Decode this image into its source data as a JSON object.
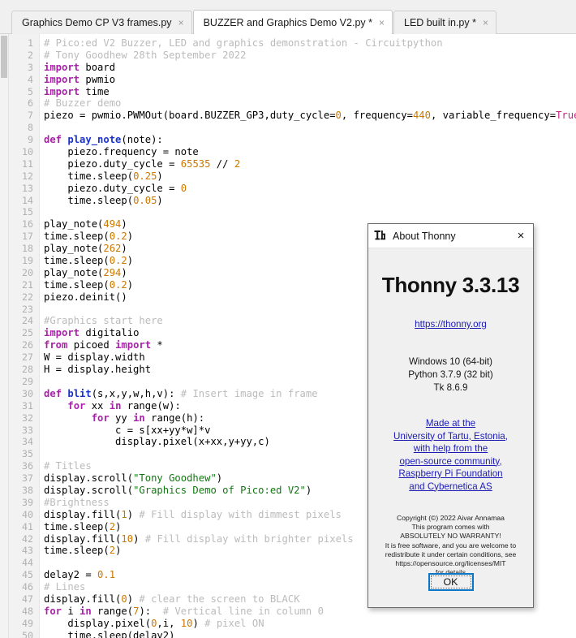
{
  "tabs": [
    {
      "label": "Graphics Demo CP V3 frames.py",
      "close_icon": "×",
      "active": false
    },
    {
      "label": "BUZZER and Graphics Demo V2.py *",
      "close_icon": "×",
      "active": true
    },
    {
      "label": "LED built in.py *",
      "close_icon": "×",
      "active": false
    }
  ],
  "editor": {
    "first_line": 1,
    "lines": [
      {
        "n": "1",
        "tokens": [
          {
            "t": "# Pico:ed V2 Buzzer, LED and graphics demonstration - Circuitpython",
            "c": "c-com"
          }
        ]
      },
      {
        "n": "2",
        "tokens": [
          {
            "t": "# Tony Goodhew 28th September 2022",
            "c": "c-com"
          }
        ]
      },
      {
        "n": "3",
        "tokens": [
          {
            "t": "import",
            "c": "c-kw"
          },
          {
            "t": " board",
            "c": "src"
          }
        ]
      },
      {
        "n": "4",
        "tokens": [
          {
            "t": "import",
            "c": "c-kw"
          },
          {
            "t": " pwmio",
            "c": "src"
          }
        ]
      },
      {
        "n": "5",
        "tokens": [
          {
            "t": "import",
            "c": "c-kw"
          },
          {
            "t": " time",
            "c": "src"
          }
        ]
      },
      {
        "n": "6",
        "tokens": [
          {
            "t": "# Buzzer demo",
            "c": "c-com"
          }
        ]
      },
      {
        "n": "7",
        "tokens": [
          {
            "t": "piezo = pwmio.PWMOut(board.BUZZER_GP3,duty_cycle=",
            "c": "src"
          },
          {
            "t": "0",
            "c": "c-num"
          },
          {
            "t": ", frequency=",
            "c": "src"
          },
          {
            "t": "440",
            "c": "c-num"
          },
          {
            "t": ", variable_frequency=",
            "c": "src"
          },
          {
            "t": "True",
            "c": "c-bool"
          },
          {
            "t": ")",
            "c": "src"
          }
        ]
      },
      {
        "n": "8",
        "tokens": []
      },
      {
        "n": "9",
        "tokens": [
          {
            "t": "def ",
            "c": "c-kw"
          },
          {
            "t": "play_note",
            "c": "c-fn"
          },
          {
            "t": "(note):",
            "c": "src"
          }
        ]
      },
      {
        "n": "10",
        "tokens": [
          {
            "t": "    piezo.frequency = note",
            "c": "src"
          }
        ]
      },
      {
        "n": "11",
        "tokens": [
          {
            "t": "    piezo.duty_cycle = ",
            "c": "src"
          },
          {
            "t": "65535",
            "c": "c-num"
          },
          {
            "t": " // ",
            "c": "src"
          },
          {
            "t": "2",
            "c": "c-num"
          }
        ]
      },
      {
        "n": "12",
        "tokens": [
          {
            "t": "    time.sleep(",
            "c": "src"
          },
          {
            "t": "0.25",
            "c": "c-num"
          },
          {
            "t": ")",
            "c": "src"
          }
        ]
      },
      {
        "n": "13",
        "tokens": [
          {
            "t": "    piezo.duty_cycle = ",
            "c": "src"
          },
          {
            "t": "0",
            "c": "c-num"
          }
        ]
      },
      {
        "n": "14",
        "tokens": [
          {
            "t": "    time.sleep(",
            "c": "src"
          },
          {
            "t": "0.05",
            "c": "c-num"
          },
          {
            "t": ")",
            "c": "src"
          }
        ]
      },
      {
        "n": "15",
        "tokens": []
      },
      {
        "n": "16",
        "tokens": [
          {
            "t": "play_note(",
            "c": "src"
          },
          {
            "t": "494",
            "c": "c-num"
          },
          {
            "t": ")",
            "c": "src"
          }
        ]
      },
      {
        "n": "17",
        "tokens": [
          {
            "t": "time.sleep(",
            "c": "src"
          },
          {
            "t": "0.2",
            "c": "c-num"
          },
          {
            "t": ")",
            "c": "src"
          }
        ]
      },
      {
        "n": "18",
        "tokens": [
          {
            "t": "play_note(",
            "c": "src"
          },
          {
            "t": "262",
            "c": "c-num"
          },
          {
            "t": ")",
            "c": "src"
          }
        ]
      },
      {
        "n": "19",
        "tokens": [
          {
            "t": "time.sleep(",
            "c": "src"
          },
          {
            "t": "0.2",
            "c": "c-num"
          },
          {
            "t": ")",
            "c": "src"
          }
        ]
      },
      {
        "n": "20",
        "tokens": [
          {
            "t": "play_note(",
            "c": "src"
          },
          {
            "t": "294",
            "c": "c-num"
          },
          {
            "t": ")",
            "c": "src"
          }
        ]
      },
      {
        "n": "21",
        "tokens": [
          {
            "t": "time.sleep(",
            "c": "src"
          },
          {
            "t": "0.2",
            "c": "c-num"
          },
          {
            "t": ")",
            "c": "src"
          }
        ]
      },
      {
        "n": "22",
        "tokens": [
          {
            "t": "piezo.deinit()",
            "c": "src"
          }
        ]
      },
      {
        "n": "23",
        "tokens": []
      },
      {
        "n": "24",
        "tokens": [
          {
            "t": "#Graphics start here",
            "c": "c-com"
          }
        ]
      },
      {
        "n": "25",
        "tokens": [
          {
            "t": "import",
            "c": "c-kw"
          },
          {
            "t": " digitalio",
            "c": "src"
          }
        ]
      },
      {
        "n": "26",
        "tokens": [
          {
            "t": "from",
            "c": "c-kw"
          },
          {
            "t": " picoed ",
            "c": "src"
          },
          {
            "t": "import",
            "c": "c-kw"
          },
          {
            "t": " *",
            "c": "src"
          }
        ]
      },
      {
        "n": "27",
        "tokens": [
          {
            "t": "W = display.width",
            "c": "src"
          }
        ]
      },
      {
        "n": "28",
        "tokens": [
          {
            "t": "H = display.height",
            "c": "src"
          }
        ]
      },
      {
        "n": "29",
        "tokens": []
      },
      {
        "n": "30",
        "tokens": [
          {
            "t": "def ",
            "c": "c-kw"
          },
          {
            "t": "blit",
            "c": "c-fn"
          },
          {
            "t": "(s,x,y,w,h,v): ",
            "c": "src"
          },
          {
            "t": "# Insert image in frame",
            "c": "c-com"
          }
        ]
      },
      {
        "n": "31",
        "tokens": [
          {
            "t": "    ",
            "c": "src"
          },
          {
            "t": "for",
            "c": "c-kw"
          },
          {
            "t": " xx ",
            "c": "src"
          },
          {
            "t": "in",
            "c": "c-kw"
          },
          {
            "t": " range(w):",
            "c": "src"
          }
        ]
      },
      {
        "n": "32",
        "tokens": [
          {
            "t": "        ",
            "c": "src"
          },
          {
            "t": "for",
            "c": "c-kw"
          },
          {
            "t": " yy ",
            "c": "src"
          },
          {
            "t": "in",
            "c": "c-kw"
          },
          {
            "t": " range(h):",
            "c": "src"
          }
        ]
      },
      {
        "n": "33",
        "tokens": [
          {
            "t": "            c = s[xx+yy*w]*v",
            "c": "src"
          }
        ]
      },
      {
        "n": "34",
        "tokens": [
          {
            "t": "            display.pixel(x+xx,y+yy,c)",
            "c": "src"
          }
        ]
      },
      {
        "n": "35",
        "tokens": []
      },
      {
        "n": "36",
        "tokens": [
          {
            "t": "# Titles",
            "c": "c-com"
          }
        ]
      },
      {
        "n": "37",
        "tokens": [
          {
            "t": "display.scroll(",
            "c": "src"
          },
          {
            "t": "\"Tony Goodhew\"",
            "c": "c-str"
          },
          {
            "t": ")",
            "c": "src"
          }
        ]
      },
      {
        "n": "38",
        "tokens": [
          {
            "t": "display.scroll(",
            "c": "src"
          },
          {
            "t": "\"Graphics Demo of Pico:ed V2\"",
            "c": "c-str"
          },
          {
            "t": ")",
            "c": "src"
          }
        ]
      },
      {
        "n": "39",
        "tokens": [
          {
            "t": "#Brightness",
            "c": "c-com"
          }
        ]
      },
      {
        "n": "40",
        "tokens": [
          {
            "t": "display.fill(",
            "c": "src"
          },
          {
            "t": "1",
            "c": "c-num"
          },
          {
            "t": ") ",
            "c": "src"
          },
          {
            "t": "# Fill display with dimmest pixels",
            "c": "c-com"
          }
        ]
      },
      {
        "n": "41",
        "tokens": [
          {
            "t": "time.sleep(",
            "c": "src"
          },
          {
            "t": "2",
            "c": "c-num"
          },
          {
            "t": ")",
            "c": "src"
          }
        ]
      },
      {
        "n": "42",
        "tokens": [
          {
            "t": "display.fill(",
            "c": "src"
          },
          {
            "t": "10",
            "c": "c-num"
          },
          {
            "t": ") ",
            "c": "src"
          },
          {
            "t": "# Fill display with brighter pixels",
            "c": "c-com"
          }
        ]
      },
      {
        "n": "43",
        "tokens": [
          {
            "t": "time.sleep(",
            "c": "src"
          },
          {
            "t": "2",
            "c": "c-num"
          },
          {
            "t": ")",
            "c": "src"
          }
        ]
      },
      {
        "n": "44",
        "tokens": []
      },
      {
        "n": "45",
        "tokens": [
          {
            "t": "delay2 = ",
            "c": "src"
          },
          {
            "t": "0.1",
            "c": "c-num"
          }
        ]
      },
      {
        "n": "46",
        "tokens": [
          {
            "t": "# Lines",
            "c": "c-com"
          }
        ]
      },
      {
        "n": "47",
        "tokens": [
          {
            "t": "display.fill(",
            "c": "src"
          },
          {
            "t": "0",
            "c": "c-num"
          },
          {
            "t": ") ",
            "c": "src"
          },
          {
            "t": "# clear the screen to BLACK",
            "c": "c-com"
          }
        ]
      },
      {
        "n": "48",
        "tokens": [
          {
            "t": "for",
            "c": "c-kw"
          },
          {
            "t": " i ",
            "c": "src"
          },
          {
            "t": "in",
            "c": "c-kw"
          },
          {
            "t": " range(",
            "c": "src"
          },
          {
            "t": "7",
            "c": "c-num"
          },
          {
            "t": "):  ",
            "c": "src"
          },
          {
            "t": "# Vertical line in column 0",
            "c": "c-com"
          }
        ]
      },
      {
        "n": "49",
        "tokens": [
          {
            "t": "    display.pixel(",
            "c": "src"
          },
          {
            "t": "0",
            "c": "c-num"
          },
          {
            "t": ",i, ",
            "c": "src"
          },
          {
            "t": "10",
            "c": "c-num"
          },
          {
            "t": ") ",
            "c": "src"
          },
          {
            "t": "# pixel ON",
            "c": "c-com"
          }
        ]
      },
      {
        "n": "50",
        "tokens": [
          {
            "t": "    time.sleep(delay2)",
            "c": "src"
          }
        ]
      }
    ]
  },
  "dialog": {
    "logo_icon": "thonny-logo-icon",
    "title": "About Thonny",
    "close_icon": "×",
    "heading": "Thonny 3.3.13",
    "url": "https://thonny.org",
    "versions": [
      "Windows 10 (64-bit)",
      "Python 3.7.9 (32 bit)",
      "Tk 8.6.9"
    ],
    "credits": [
      "Made at the",
      "University of Tartu, Estonia,",
      "with help from the",
      "open-source community,",
      "Raspberry Pi Foundation",
      "and Cybernetica AS"
    ],
    "legal": [
      "Copyright (©) 2022 Aivar Annamaa",
      "This program comes with",
      "ABSOLUTELY NO WARRANTY!",
      "It is free software, and you are welcome to",
      "redistribute it under certain conditions, see",
      "https://opensource.org/licenses/MIT",
      "for details"
    ],
    "ok_label": "OK"
  },
  "colors": {
    "keyword": "#aa22aa",
    "function": "#1a33cc",
    "comment": "#bbbbbb",
    "number": "#cc7700",
    "string": "#117711",
    "boolean": "#cc2288",
    "link": "#1c1cb5",
    "focus_border": "#0a76c8"
  }
}
